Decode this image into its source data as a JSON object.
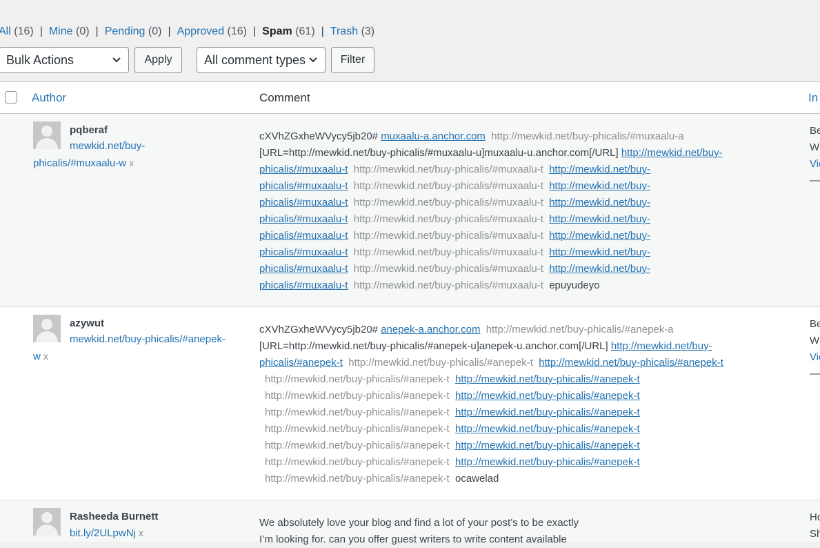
{
  "filters": {
    "all": {
      "label": "All",
      "count": "(16)"
    },
    "mine": {
      "label": "Mine",
      "count": "(0)"
    },
    "pending": {
      "label": "Pending",
      "count": "(0)"
    },
    "approved": {
      "label": "Approved",
      "count": "(16)"
    },
    "spam": {
      "label": "Spam",
      "count": "(61)"
    },
    "trash": {
      "label": "Trash",
      "count": "(3)"
    },
    "separator": "|"
  },
  "toolbar": {
    "bulk_actions": "Bulk Actions",
    "apply": "Apply",
    "comment_types": "All comment types",
    "filter": "Filter",
    "chevron": "⌄"
  },
  "table": {
    "headers": {
      "author": "Author",
      "comment": "Comment",
      "in_response": "In"
    }
  },
  "rows": [
    {
      "author_name": "pqberaf",
      "author_url_1": "mewkid.net/buy-",
      "author_url_2": "phicalis/#muxaalu-w",
      "remove": "x",
      "line1_text": "cXVhZGxheWVycy5jb20# ",
      "line1_link": "muxaalu-a.anchor.com",
      "line1_gray": "  http://mewkid.net/buy-phicalis/#muxaalu-a",
      "line2_text": "[URL=http://mewkid.net/buy-phicalis/#muxaalu-u]muxaalu-u.anchor.com[/URL] ",
      "line2_link": "http://mewkid.net/buy-",
      "rep_link_a": "phicalis/#muxaalu-t",
      "rep_gray": "  http://mewkid.net/buy-phicalis/#muxaalu-t  ",
      "rep_link_b": "http://mewkid.net/buy-",
      "last_word": "epuyudeyo",
      "in_1": "Be",
      "in_2": "W",
      "in_3": "Vie",
      "in_4": "—"
    },
    {
      "author_name": "azywut",
      "author_url_1": "mewkid.net/buy-phicalis/#anepek-",
      "author_url_2": "w",
      "remove": "x",
      "line1_text": "cXVhZGxheWVycy5jb20# ",
      "line1_link": "anepek-a.anchor.com",
      "line1_gray": "  http://mewkid.net/buy-phicalis/#anepek-a",
      "line2_text": "[URL=http://mewkid.net/buy-phicalis/#anepek-u]anepek-u.anchor.com[/URL] ",
      "line2_link": "http://mewkid.net/buy-",
      "line3_link_a": "phicalis/#anepek-t",
      "line3_gray": "  http://mewkid.net/buy-phicalis/#anepek-t  ",
      "line3_link_b": "http://mewkid.net/buy-phicalis/#anepek-t",
      "rep_gray": "http://mewkid.net/buy-phicalis/#anepek-t  ",
      "rep_link": "http://mewkid.net/buy-phicalis/#anepek-t",
      "last_word": "ocawelad",
      "in_1": "Be",
      "in_2": "W",
      "in_3": "Vie",
      "in_4": "—"
    },
    {
      "author_name": "Rasheeda Burnett",
      "author_url_1": "bit.ly/2ULpwNj",
      "remove": "x",
      "line1": "We absolutely love your blog and find a lot of your post’s to be exactly",
      "line2": "I’m looking for. can you offer guest writers to write content available",
      "in_1": "Ho",
      "in_2": "Sh"
    }
  ]
}
